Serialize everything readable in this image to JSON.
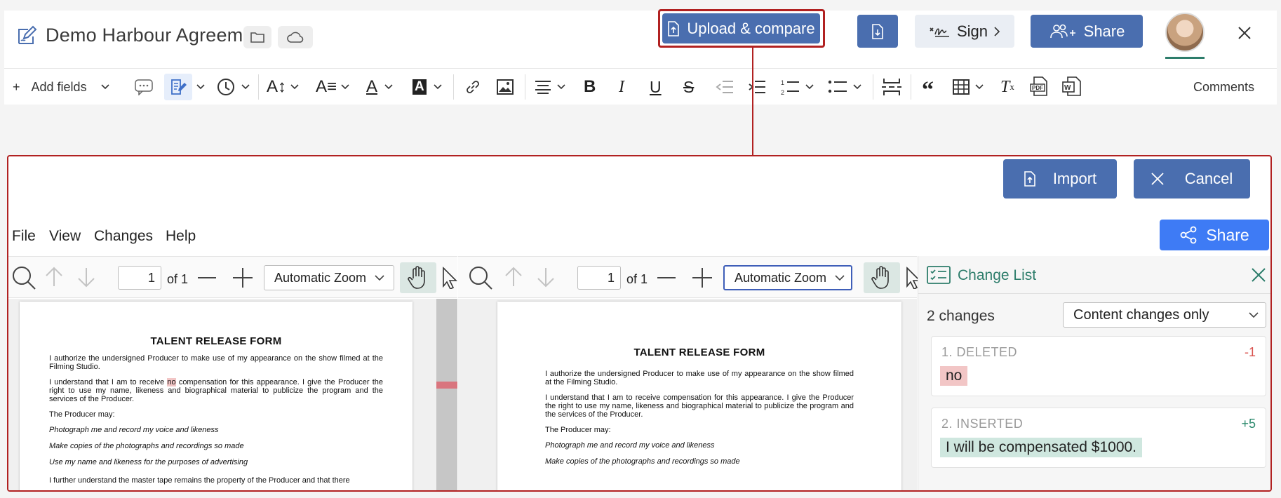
{
  "header": {
    "title": "Demo Harbour Agreement",
    "upload_label": "Upload & compare",
    "sign_label": "Sign",
    "share_label": "Share"
  },
  "toolbar": {
    "add_fields_label": "Add fields",
    "comments_label": "Comments"
  },
  "dialog": {
    "import_label": "Import",
    "cancel_label": "Cancel",
    "share_label": "Share",
    "menu": [
      "File",
      "View",
      "Changes",
      "Help"
    ],
    "left_viewer": {
      "page": "1",
      "of_text": "of 1",
      "zoom": "Automatic Zoom"
    },
    "right_viewer": {
      "page": "1",
      "of_text": "of 1",
      "zoom": "Automatic Zoom"
    }
  },
  "doc_left": {
    "title": "TALENT RELEASE FORM",
    "p1": "I authorize the undersigned Producer to make use of my appearance on the show filmed at the Filming Studio.",
    "p2_before": "I understand that I am to receive ",
    "p2_deleted": "no",
    "p2_after": " compensation for this appearance. I give the Producer the right to use my name, likeness and biographical material to publicize the program and the services of the Producer.",
    "p3": "The Producer may:",
    "i1": "Photograph me and record my voice and likeness",
    "i2": "Make copies of the photographs and recordings so made",
    "i3": "Use my name and likeness for the purposes of advertising",
    "p4": "I further understand the master tape remains the property of the Producer and that there"
  },
  "doc_right": {
    "title": "TALENT RELEASE FORM",
    "p1": "I authorize the undersigned Producer to make use of my appearance on the show filmed at the Filming Studio.",
    "p2": "I understand that I am to receive compensation for this appearance. I give the Producer the right to use my name, likeness and biographical material to publicize the program and the services of the Producer.",
    "p3": "The Producer may:",
    "i1": "Photograph me and record my voice and likeness",
    "i2": "Make copies of the photographs and recordings so made"
  },
  "change_list": {
    "title": "Change List",
    "count": "2 changes",
    "filter": "Content changes only",
    "items": [
      {
        "label": "1. DELETED",
        "delta": "-1",
        "text": "no",
        "color": "#d9534f"
      },
      {
        "label": "2. INSERTED",
        "delta": "+5",
        "text": "I will be compensated $1000.",
        "color": "#2d8a6e"
      }
    ]
  },
  "colors": {
    "accent_blue": "#4a6eaf",
    "share_blue": "#3e7bf5",
    "highlight_red": "#b12121",
    "teal": "#2d7d6b"
  }
}
